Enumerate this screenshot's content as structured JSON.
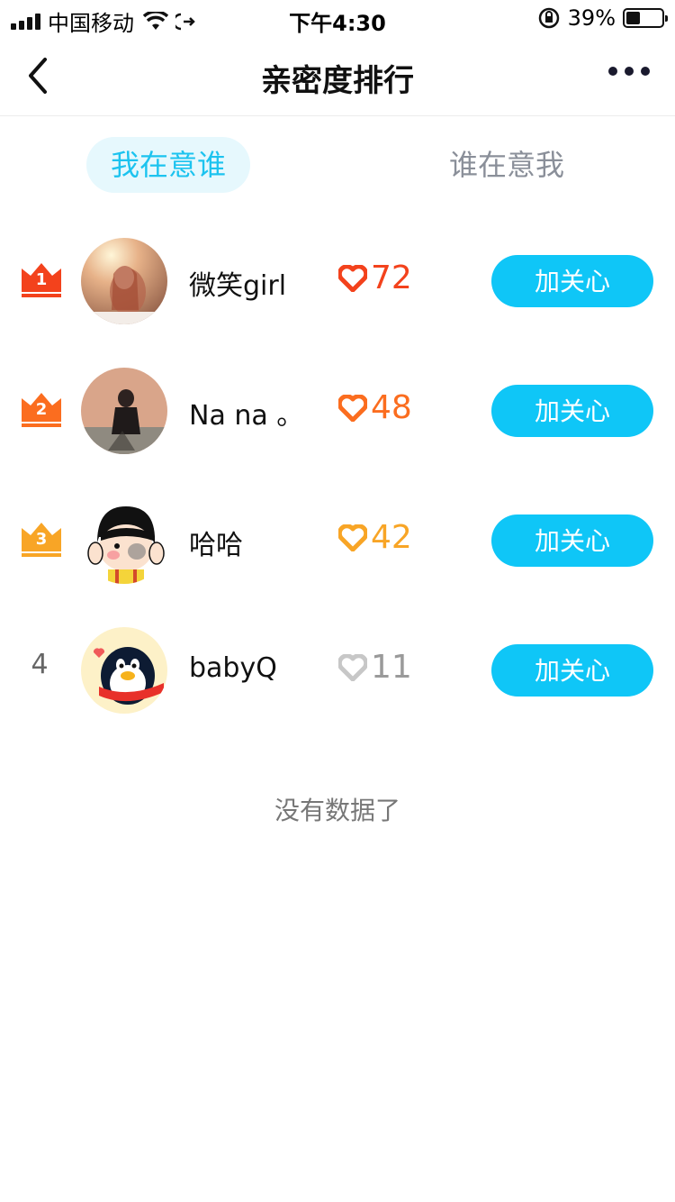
{
  "status_bar": {
    "carrier": "中国移动",
    "time": "下午4:30",
    "battery_text": "39%",
    "battery_level": 0.39
  },
  "nav": {
    "title": "亲密度排行",
    "back_icon": "chevron-left-icon",
    "more_icon": "more-dots-icon"
  },
  "tabs": [
    {
      "label": "我在意谁",
      "active": true
    },
    {
      "label": "谁在意我",
      "active": false
    }
  ],
  "ranking": [
    {
      "rank": "1",
      "name": "微笑girl",
      "score": "72",
      "button": "加关心",
      "rank_color": "#f3421c",
      "heart_color": "#f3421c"
    },
    {
      "rank": "2",
      "name": "Na na 。",
      "score": "48",
      "button": "加关心",
      "rank_color": "#fb6d1f",
      "heart_color": "#fb6d1f"
    },
    {
      "rank": "3",
      "name": "哈哈",
      "score": "42",
      "button": "加关心",
      "rank_color": "#f8a526",
      "heart_color": "#f8a526"
    },
    {
      "rank": "4",
      "name": "babyQ",
      "score": "11",
      "button": "加关心",
      "rank_color": "#666666",
      "heart_color": "#c7c7c7"
    }
  ],
  "footer": {
    "text": "没有数据了"
  },
  "colors": {
    "accent": "#0fc6f7",
    "tab_active_bg": "#e6f8fd",
    "tab_active_text": "#1cc3ef",
    "tab_inactive_text": "#8a8f99"
  }
}
